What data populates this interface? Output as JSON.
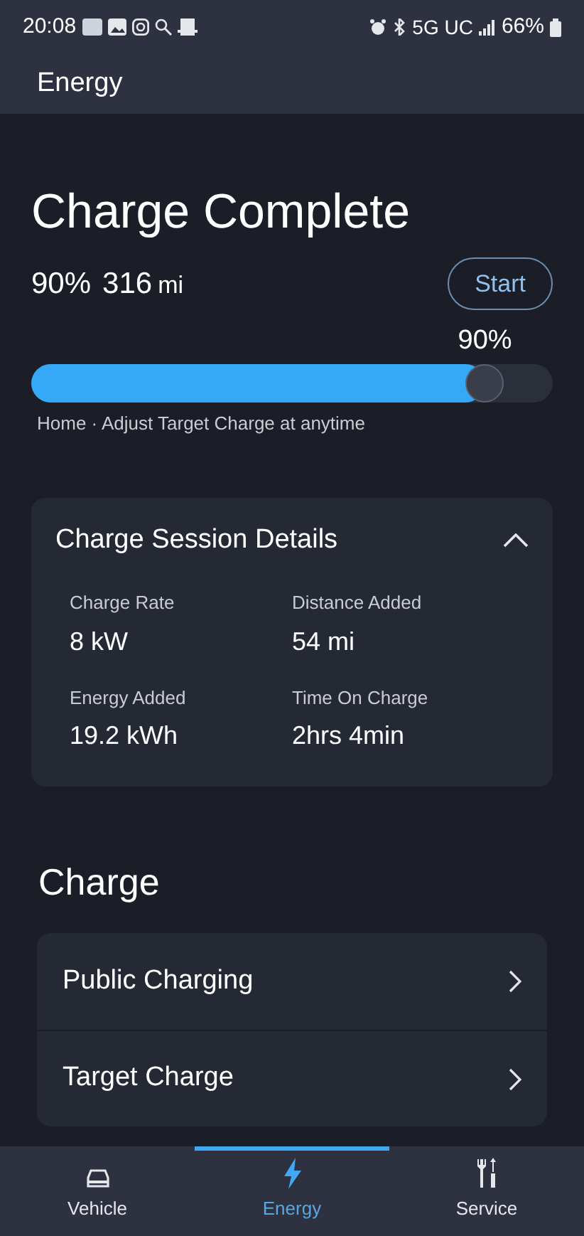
{
  "status_bar": {
    "time": "20:08",
    "network": "5G UC",
    "battery": "66%"
  },
  "header": {
    "title": "Energy"
  },
  "charge_status": {
    "title": "Charge Complete",
    "percent": "90%",
    "range_value": "316",
    "range_unit": "mi",
    "start_button": "Start"
  },
  "target_slider": {
    "label": "90%",
    "level": 0.9,
    "caption": "Home · Adjust Target Charge at anytime"
  },
  "session_details": {
    "title": "Charge Session Details",
    "expanded": true,
    "items": [
      {
        "label": "Charge Rate",
        "value": "8 kW"
      },
      {
        "label": "Distance Added",
        "value": "54 mi"
      },
      {
        "label": "Energy Added",
        "value": "19.2 kWh"
      },
      {
        "label": "Time On Charge",
        "value": "2hrs 4min"
      }
    ]
  },
  "charge_section": {
    "title": "Charge",
    "items": [
      {
        "label": "Public Charging"
      },
      {
        "label": "Target Charge"
      }
    ]
  },
  "bottom_nav": [
    {
      "label": "Vehicle",
      "kind": "vehicle",
      "selected": false
    },
    {
      "label": "Energy",
      "kind": "energy",
      "selected": true
    },
    {
      "label": "Service",
      "kind": "service",
      "selected": false
    }
  ]
}
